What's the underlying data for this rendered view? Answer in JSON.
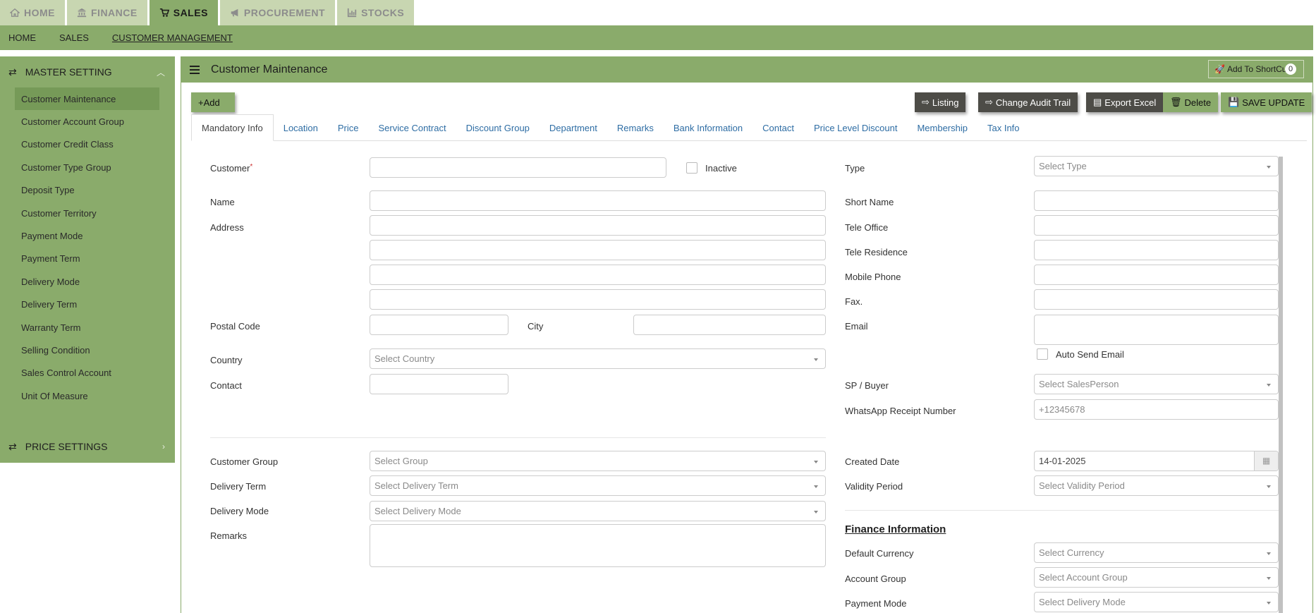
{
  "top_tabs": [
    {
      "label": "HOME",
      "icon": "home-icon"
    },
    {
      "label": "FINANCE",
      "icon": "bank-icon"
    },
    {
      "label": "SALES",
      "icon": "cart-icon"
    },
    {
      "label": "PROCUREMENT",
      "icon": "bullhorn-icon"
    },
    {
      "label": "STOCKS",
      "icon": "bar-chart-icon"
    }
  ],
  "nav": {
    "home": "HOME",
    "sales": "SALES",
    "customer_management": "CUSTOMER MANAGEMENT"
  },
  "sidebar": {
    "master_setting": "MASTER SETTING",
    "items": [
      "Customer Maintenance",
      "Customer Account Group",
      "Customer Credit Class",
      "Customer Type Group",
      "Deposit Type",
      "Customer Territory",
      "Payment Mode",
      "Payment Term",
      "Delivery Mode",
      "Delivery Term",
      "Warranty Term",
      "Selling Condition",
      "Sales Control Account",
      "Unit Of Measure"
    ],
    "price_settings": "PRICE SETTINGS"
  },
  "panel": {
    "title": "Customer Maintenance",
    "shortcut": "Add To ShortCut",
    "shortcut_count": "0"
  },
  "toolbar": {
    "add": "+Add",
    "listing": "Listing",
    "audit": "Change Audit Trail",
    "export": "Export Excel",
    "delete": "Delete",
    "save": "SAVE UPDATE"
  },
  "tabs": [
    "Mandatory Info",
    "Location",
    "Price",
    "Service Contract",
    "Discount Group",
    "Department",
    "Remarks",
    "Bank Information",
    "Contact",
    "Price Level Discount",
    "Membership",
    "Tax Info"
  ],
  "form": {
    "customer": "Customer",
    "required_mark": "*",
    "inactive": "Inactive",
    "name": "Name",
    "address": "Address",
    "postal_code": "Postal Code",
    "city": "City",
    "country": "Country",
    "country_ph": "Select Country",
    "contact": "Contact",
    "type": "Type",
    "type_ph": "Select Type",
    "short_name": "Short Name",
    "tele_office": "Tele Office",
    "tele_residence": "Tele Residence",
    "mobile_phone": "Mobile Phone",
    "fax": "Fax.",
    "email": "Email",
    "auto_send_email": "Auto Send Email",
    "sp_buyer": "SP / Buyer",
    "sp_ph": "Select SalesPerson",
    "whatsapp": "WhatsApp Receipt Number",
    "whatsapp_ph": "+12345678",
    "customer_group": "Customer Group",
    "group_ph": "Select Group",
    "delivery_term": "Delivery Term",
    "delivery_term_ph": "Select Delivery Term",
    "delivery_mode": "Delivery Mode",
    "delivery_mode_ph": "Select Delivery Mode",
    "remarks": "Remarks",
    "created_date": "Created Date",
    "created_date_value": "14-01-2025",
    "validity_period": "Validity Period",
    "validity_ph": "Select Validity Period",
    "finance_info": "Finance Information",
    "default_currency": "Default Currency",
    "currency_ph": "Select Currency",
    "account_group": "Account Group",
    "account_group_ph": "Select Account Group",
    "payment_mode": "Payment Mode",
    "payment_mode_ph": "Select Delivery Mode"
  }
}
